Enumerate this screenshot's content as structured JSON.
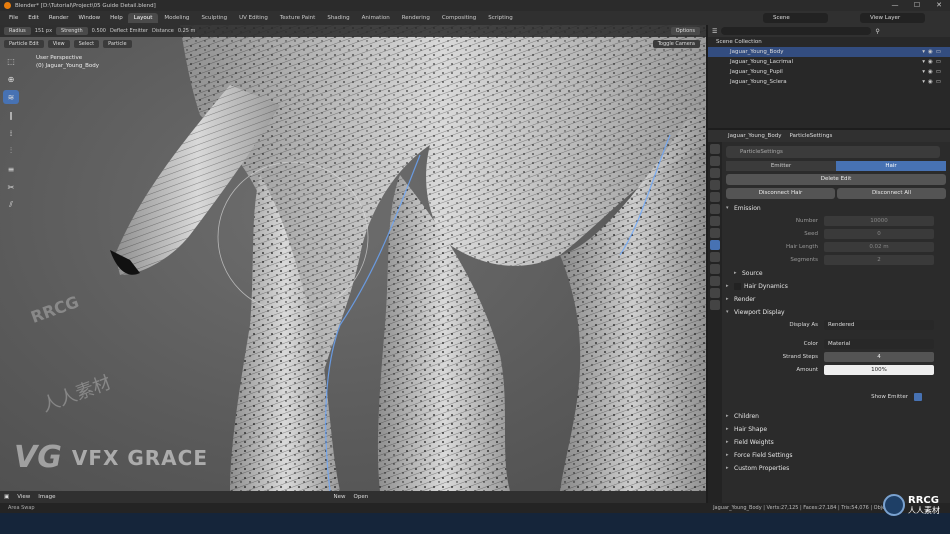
{
  "window": {
    "title": "Blender* [D:\\Tutorial\\Project\\05 Guide Detail.blend]",
    "controls": [
      "—",
      "☐",
      "✕"
    ]
  },
  "menu": {
    "items": [
      "File",
      "Edit",
      "Render",
      "Window",
      "Help"
    ],
    "workspaces": [
      "Layout",
      "Modeling",
      "Sculpting",
      "UV Editing",
      "Texture Paint",
      "Shading",
      "Animation",
      "Rendering",
      "Compositing",
      "Scripting"
    ],
    "active_workspace": "Layout"
  },
  "scene": {
    "scene": "Scene",
    "view_layer": "View Layer"
  },
  "viewport": {
    "header": {
      "radius_label": "Radius",
      "radius_value": "151 px",
      "strength_label": "Strength",
      "strength_value": "0.500",
      "deflect": "Deflect Emitter",
      "distance_label": "Distance",
      "distance_value": "0.25 m",
      "options": "Options"
    },
    "header2": {
      "mode": "Particle Edit",
      "view": "View",
      "select": "Select",
      "particle": "Particle",
      "toggle_camera": "Toggle Camera"
    },
    "info_line1": "User Perspective",
    "info_line2": "(0) Jaguar_Young_Body",
    "footer": {
      "view": "View",
      "image": "Image",
      "new": "New",
      "open": "Open"
    }
  },
  "outliner": {
    "collection": "Scene Collection",
    "rows": [
      {
        "name": "Jaguar_Young_Body",
        "selected": true
      },
      {
        "name": "Jaguar_Young_Lacrimal",
        "selected": false
      },
      {
        "name": "Jaguar_Young_Pupil",
        "selected": false
      },
      {
        "name": "Jaguar_Young_Sclera",
        "selected": false
      }
    ]
  },
  "properties": {
    "object": "Jaguar_Young_Body",
    "settings": "ParticleSettings",
    "system_name": "ParticleSettings",
    "seg": {
      "emitter": "Emitter",
      "hair": "Hair"
    },
    "delete_edit": "Delete Edit",
    "disconnect_hair": "Disconnect Hair",
    "disconnect_all": "Disconnect All",
    "emission": "Emission",
    "number_label": "Number",
    "number_value": "10000",
    "seed_label": "Seed",
    "seed_value": "0",
    "hair_length_label": "Hair Length",
    "hair_length_value": "0.02 m",
    "segments_label": "Segments",
    "segments_value": "2",
    "source": "Source",
    "hair_dynamics": "Hair Dynamics",
    "render": "Render",
    "viewport_display": "Viewport Display",
    "display_as_label": "Display As",
    "display_as_value": "Rendered",
    "color_label": "Color",
    "color_value": "Material",
    "strand_steps_label": "Strand Steps",
    "strand_steps_value": "4",
    "amount_label": "Amount",
    "amount_value": "100%",
    "show_emitter": "Show Emitter",
    "children": "Children",
    "hair_shape": "Hair Shape",
    "field_weights": "Field Weights",
    "force_field": "Force Field Settings",
    "custom_props": "Custom Properties"
  },
  "status": {
    "left": "Area Swap",
    "right": "Jaguar_Young_Body | Verts:27,125 | Faces:27,184 | Tris:54,076 | Objec"
  },
  "watermarks": {
    "vfx_text": "VFX GRACE",
    "rrcg": "RRCG",
    "rrcg_cn": "人人素材",
    "cn_text": "人人素材"
  },
  "colors": {
    "accent": "#4772b3",
    "selection": "#334d80",
    "bg": "#2b2b2b"
  }
}
